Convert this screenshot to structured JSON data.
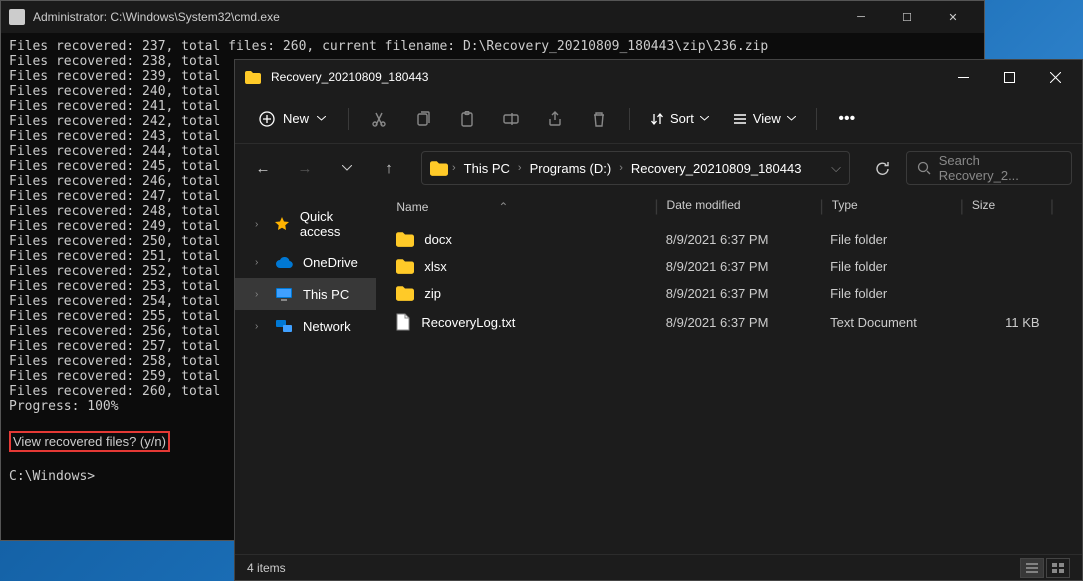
{
  "cmd": {
    "title": "Administrator: C:\\Windows\\System32\\cmd.exe",
    "first_line": "Files recovered: 237, total files: 260, current filename: D:\\Recovery_20210809_180443\\zip\\236.zip",
    "progress": "Progress: 100%",
    "prompt_question": "View recovered files? (y/n)",
    "final_prompt": "C:\\Windows>",
    "recovered_start": 238,
    "recovered_end": 260,
    "line_prefix": "Files recovered: ",
    "line_suffix": ", total"
  },
  "explorer": {
    "title": "Recovery_20210809_180443",
    "toolbar": {
      "new": "New",
      "sort": "Sort",
      "view": "View"
    },
    "breadcrumb": {
      "root": "This PC",
      "drive": "Programs (D:)",
      "folder": "Recovery_20210809_180443"
    },
    "search_placeholder": "Search Recovery_2...",
    "sidebar": [
      {
        "label": "Quick access",
        "icon": "star",
        "active": false
      },
      {
        "label": "OneDrive",
        "icon": "cloud",
        "active": false
      },
      {
        "label": "This PC",
        "icon": "pc",
        "active": true
      },
      {
        "label": "Network",
        "icon": "network",
        "active": false
      }
    ],
    "columns": {
      "name": "Name",
      "date": "Date modified",
      "type": "Type",
      "size": "Size"
    },
    "rows": [
      {
        "name": "docx",
        "date": "8/9/2021 6:37 PM",
        "type": "File folder",
        "size": "",
        "kind": "folder"
      },
      {
        "name": "xlsx",
        "date": "8/9/2021 6:37 PM",
        "type": "File folder",
        "size": "",
        "kind": "folder"
      },
      {
        "name": "zip",
        "date": "8/9/2021 6:37 PM",
        "type": "File folder",
        "size": "",
        "kind": "folder"
      },
      {
        "name": "RecoveryLog.txt",
        "date": "8/9/2021 6:37 PM",
        "type": "Text Document",
        "size": "11 KB",
        "kind": "file"
      }
    ],
    "status": "4 items"
  }
}
